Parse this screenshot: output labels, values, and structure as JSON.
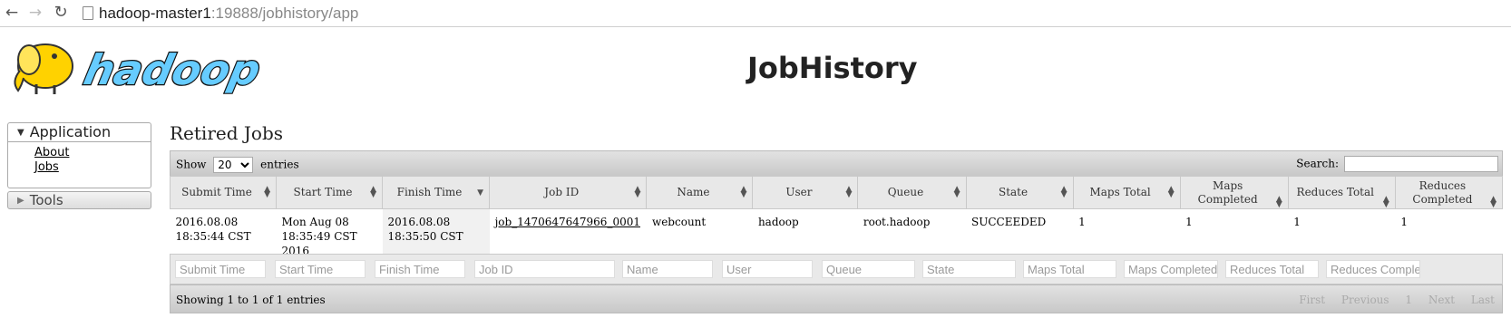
{
  "browser": {
    "url_host": "hadoop-master1",
    "url_rest": ":19888/jobhistory/app"
  },
  "header": {
    "logo_alt": "hadoop",
    "title": "JobHistory"
  },
  "sidebar": {
    "application_label": "Application",
    "links": [
      "About",
      "Jobs"
    ],
    "tools_label": "Tools"
  },
  "main": {
    "section_title": "Retired Jobs",
    "show_label": "Show",
    "page_size": "20",
    "entries_label": "entries",
    "search_label": "Search:",
    "columns": [
      "Submit Time",
      "Start Time",
      "Finish Time",
      "Job ID",
      "Name",
      "User",
      "Queue",
      "State",
      "Maps Total",
      "Maps Completed",
      "Reduces Total",
      "Reduces Completed"
    ],
    "rows": [
      {
        "submit_time": "2016.08.08 18:35:44 CST",
        "start_time": "Mon Aug 08 18:35:49 CST 2016",
        "finish_time": "2016.08.08 18:35:50 CST",
        "job_id": "job_1470647647966_0001",
        "name": "webcount",
        "user": "hadoop",
        "queue": "root.hadoop",
        "state": "SUCCEEDED",
        "maps_total": "1",
        "maps_completed": "1",
        "reduces_total": "1",
        "reduces_completed": "1"
      }
    ],
    "filters": [
      "Submit Time",
      "Start Time",
      "Finish Time",
      "Job ID",
      "Name",
      "User",
      "Queue",
      "State",
      "Maps Total",
      "Maps Completed",
      "Reduces Total",
      "Reduces Complet"
    ],
    "info": "Showing 1 to 1 of 1 entries",
    "pager": {
      "first": "First",
      "previous": "Previous",
      "page": "1",
      "next": "Next",
      "last": "Last"
    }
  },
  "colors": {
    "header_bg": "#e8e8e8",
    "toolbar_bg": "#d4d4d4",
    "logo_blue": "#66ccff",
    "logo_yellow": "#ffd200"
  }
}
